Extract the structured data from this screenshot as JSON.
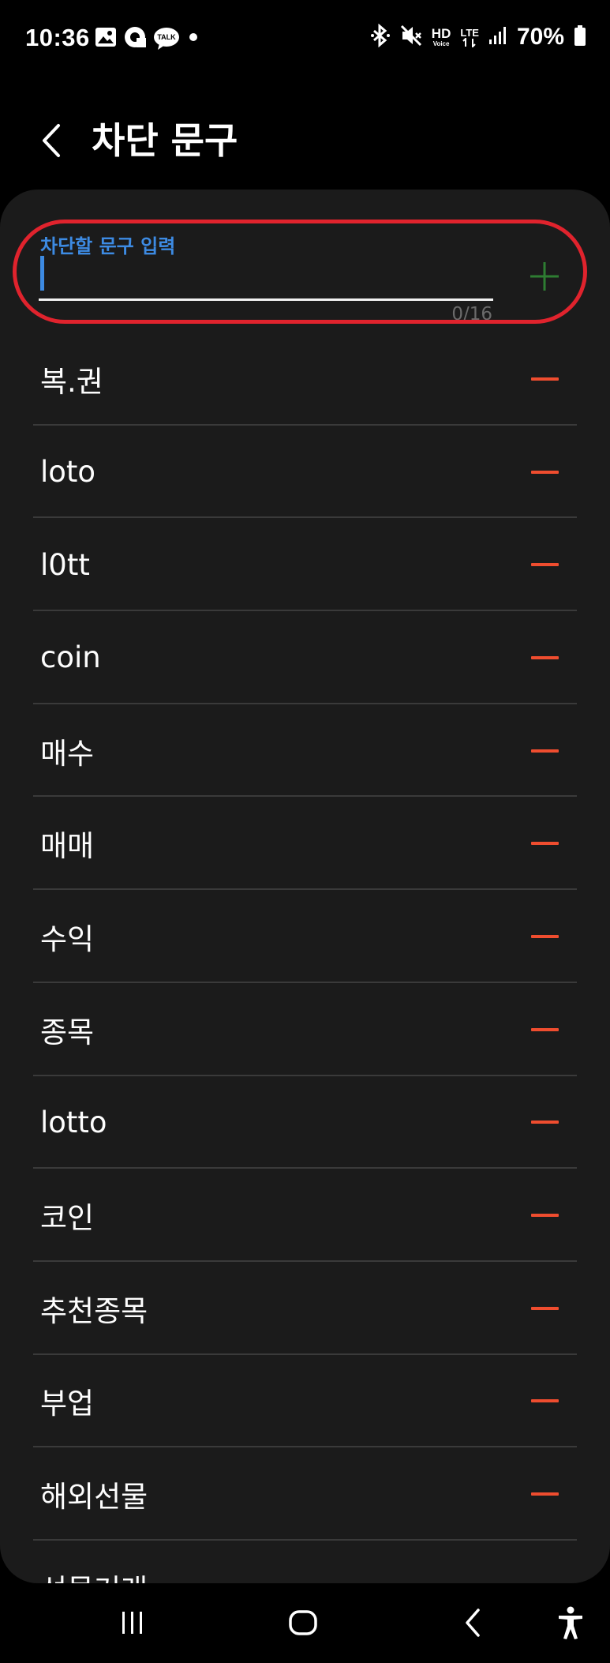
{
  "status_bar": {
    "time": "10:36",
    "notification_icons": [
      "gallery-icon",
      "assistant-icon",
      "kakaotalk-icon",
      "more-dot-icon"
    ],
    "kakaotalk_badge_text": "TALK",
    "system_icons": [
      "bluetooth-icon",
      "mute-icon",
      "hd-voice-icon",
      "lte-icon",
      "signal-icon"
    ],
    "hd_top": "HD",
    "hd_bottom": "Voice",
    "lte_text": "LTE",
    "battery_text": "70%"
  },
  "header": {
    "title": "차단 문구",
    "back_icon": "chevron-left-icon"
  },
  "input": {
    "label": "차단할 문구 입력",
    "value": "",
    "char_count": "0/16",
    "add_icon": "plus-icon"
  },
  "blocked_phrases": [
    {
      "label": "복.권"
    },
    {
      "label": "loto"
    },
    {
      "label": "l0tt"
    },
    {
      "label": "coin"
    },
    {
      "label": "매수"
    },
    {
      "label": "매매"
    },
    {
      "label": "수익"
    },
    {
      "label": "종목"
    },
    {
      "label": "lotto"
    },
    {
      "label": "코인"
    },
    {
      "label": "추천종목"
    },
    {
      "label": "부업"
    },
    {
      "label": "해외선물"
    },
    {
      "label": "선물거래"
    }
  ],
  "colors": {
    "accent_blue": "#3d8be3",
    "remove_red": "#ef4d2f",
    "add_green": "#2e7d32",
    "highlight_red": "#e0232d",
    "card_bg": "#1b1b1b"
  },
  "nav_bar": {
    "icons": [
      "recent-apps-icon",
      "home-icon",
      "back-icon",
      "accessibility-icon"
    ]
  }
}
